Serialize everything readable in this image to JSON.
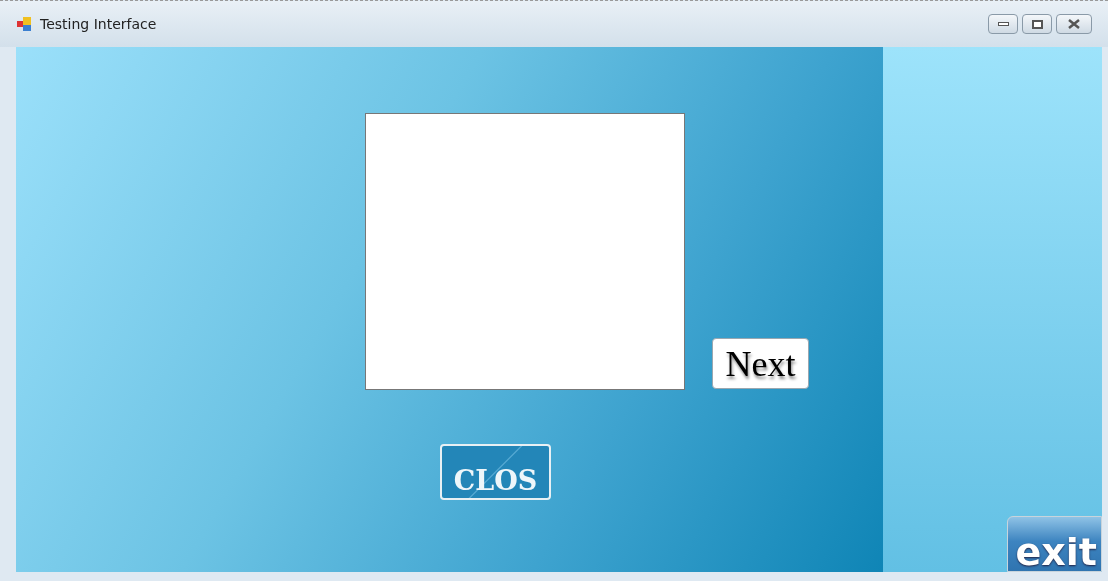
{
  "window": {
    "title": "Testing Interface"
  },
  "buttons": [
    {
      "kind": "next",
      "label": "Next"
    },
    {
      "kind": "clos",
      "label": "CLOS"
    },
    {
      "kind": "exit",
      "label": "exit"
    }
  ]
}
